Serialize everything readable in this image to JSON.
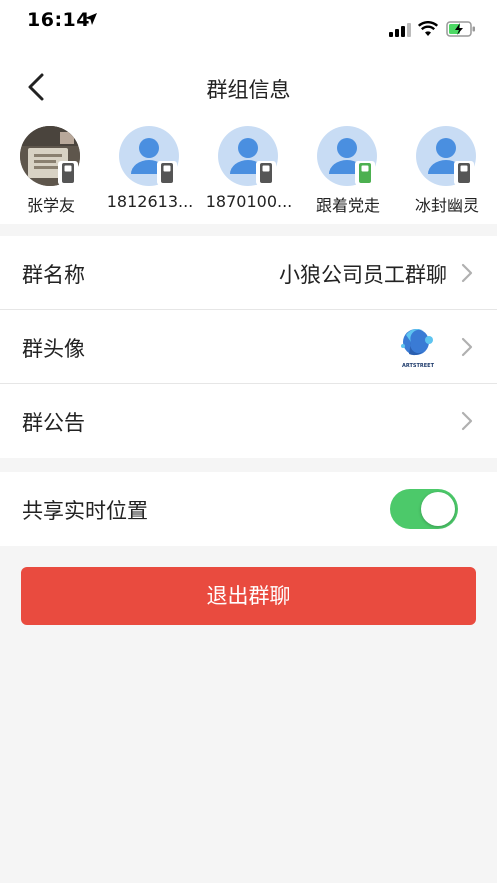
{
  "status_bar": {
    "time": "16:14",
    "icons": [
      "location-arrow-icon",
      "signal-icon",
      "wifi-icon",
      "battery-charging-icon"
    ]
  },
  "nav": {
    "title": "群组信息",
    "back_icon": "chevron-left-icon"
  },
  "members": [
    {
      "name": "张学友",
      "avatar": "photo",
      "device_color": "#555555"
    },
    {
      "name": "1812613...",
      "avatar": "default-user",
      "device_color": "#555555"
    },
    {
      "name": "1870100...",
      "avatar": "default-user",
      "device_color": "#555555"
    },
    {
      "name": "跟着党走",
      "avatar": "default-user",
      "device_color": "#4cb050"
    },
    {
      "name": "冰封幽灵",
      "avatar": "default-user",
      "device_color": "#555555"
    }
  ],
  "settings": {
    "group_name_label": "群名称",
    "group_name_value": "小狼公司员工群聊",
    "group_avatar_label": "群头像",
    "group_avatar_logo_text": "ARTSTREET",
    "group_notice_label": "群公告"
  },
  "location": {
    "label": "共享实时位置",
    "enabled": true
  },
  "exit_button": "退出群聊",
  "colors": {
    "accent_red": "#e94b3f",
    "toggle_green": "#4cc96a",
    "avatar_blue": "#c8dcf4"
  }
}
